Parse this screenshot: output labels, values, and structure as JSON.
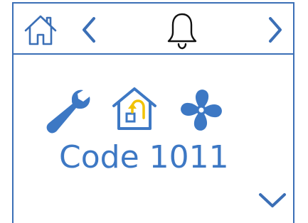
{
  "header": {
    "home_icon": "home-icon",
    "prev_icon": "chevron-left-icon",
    "bell_icon": "bell-icon",
    "next_icon": "chevron-right-icon"
  },
  "status": {
    "icons": [
      "wrench-icon",
      "house-return-icon",
      "fan-icon"
    ],
    "code_label": "Code 1011"
  },
  "footer": {
    "more_icon": "chevron-down-icon"
  },
  "colors": {
    "primary": "#3b6fb6",
    "accent": "#3d78c4",
    "highlight": "#f2c200"
  }
}
